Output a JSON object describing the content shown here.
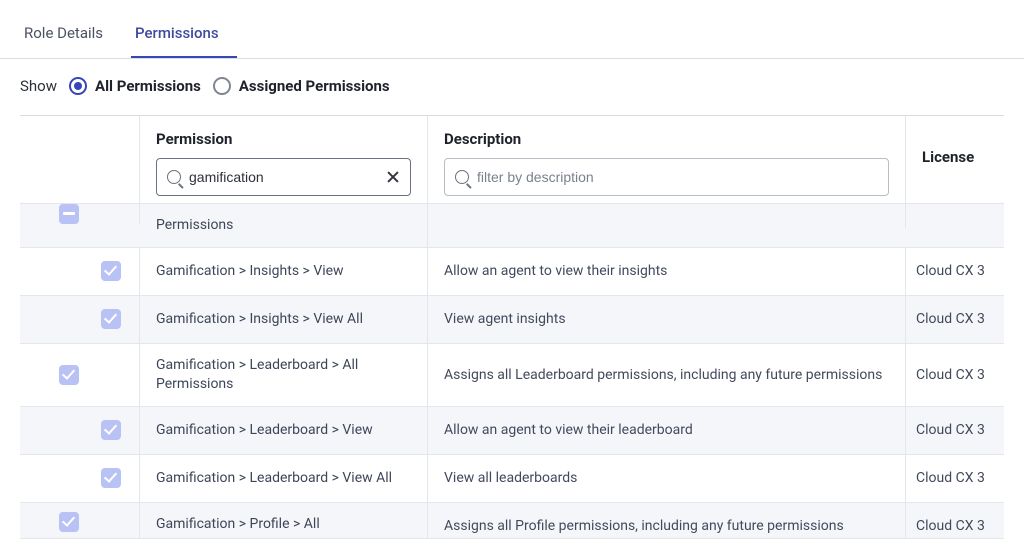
{
  "tabs": {
    "role_details": "Role Details",
    "permissions": "Permissions"
  },
  "filter_row": {
    "show_label": "Show",
    "all_label": "All Permissions",
    "assigned_label": "Assigned Permissions"
  },
  "table": {
    "headers": {
      "permission": "Permission",
      "description": "Description",
      "license": "License"
    },
    "filters": {
      "permission_value": "gamification",
      "description_placeholder": "filter by description"
    },
    "rows": [
      {
        "zebra": true,
        "cutoff": "top",
        "checkbox1": "partial",
        "checkbox2": null,
        "permission": "Permissions",
        "description": "",
        "license": ""
      },
      {
        "zebra": false,
        "checkbox1": null,
        "checkbox2": "checked",
        "permission": "Gamification > Insights > View",
        "description": "Allow an agent to view their insights",
        "license": "Cloud CX 3"
      },
      {
        "zebra": true,
        "checkbox1": null,
        "checkbox2": "checked",
        "permission": "Gamification > Insights > View All",
        "description": "View agent insights",
        "license": "Cloud CX 3"
      },
      {
        "zebra": false,
        "checkbox1": "checked",
        "checkbox2": null,
        "permission": "Gamification > Leaderboard > All Permissions",
        "description": "Assigns all Leaderboard permissions, including any future permissions",
        "license": "Cloud CX 3"
      },
      {
        "zebra": true,
        "checkbox1": null,
        "checkbox2": "checked",
        "permission": "Gamification > Leaderboard > View",
        "description": "Allow an agent to view their leaderboard",
        "license": "Cloud CX 3"
      },
      {
        "zebra": false,
        "checkbox1": null,
        "checkbox2": "checked",
        "permission": "Gamification > Leaderboard > View All",
        "description": "View all leaderboards",
        "license": "Cloud CX 3"
      },
      {
        "zebra": true,
        "cutoff": "bottom",
        "checkbox1": "checked",
        "checkbox2": null,
        "permission": "Gamification > Profile > All",
        "description": "Assigns all Profile permissions, including any future permissions",
        "license": "Cloud CX 3"
      }
    ]
  }
}
